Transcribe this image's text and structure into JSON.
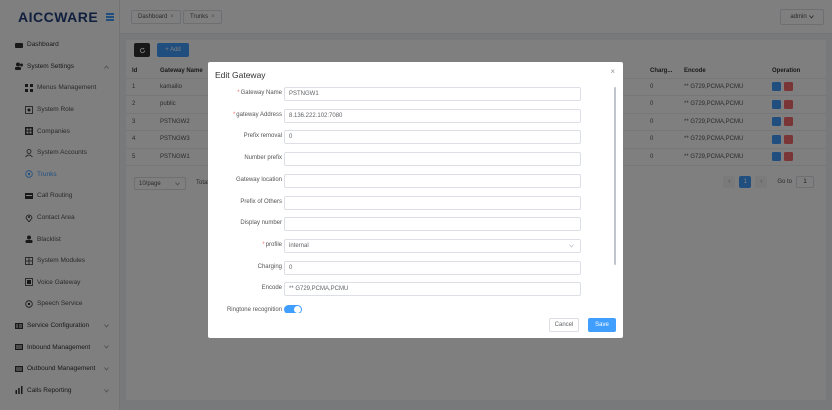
{
  "app": {
    "logo": "AICCWARE"
  },
  "sidebar": {
    "items": [
      {
        "label": "Dashboard",
        "icon": "dashboard-icon"
      },
      {
        "label": "System Settings",
        "icon": "users-icon"
      },
      {
        "label": "Menus Management",
        "icon": "grid-icon"
      },
      {
        "label": "System Role",
        "icon": "role-icon"
      },
      {
        "label": "Companies",
        "icon": "company-icon"
      },
      {
        "label": "System Accounts",
        "icon": "account-icon"
      },
      {
        "label": "Trunks",
        "icon": "trunk-icon"
      },
      {
        "label": "Call Routing",
        "icon": "routing-icon"
      },
      {
        "label": "Contact Area",
        "icon": "location-icon"
      },
      {
        "label": "Blacklist",
        "icon": "blacklist-icon"
      },
      {
        "label": "System Modules",
        "icon": "modules-icon"
      },
      {
        "label": "Voice Gateway",
        "icon": "gateway-icon"
      },
      {
        "label": "Speech Service",
        "icon": "speech-icon"
      },
      {
        "label": "Service Configuration",
        "icon": "config-icon"
      },
      {
        "label": "Inbound Management",
        "icon": "inbound-icon"
      },
      {
        "label": "Outbound Management",
        "icon": "outbound-icon"
      },
      {
        "label": "Calls Reporting",
        "icon": "report-icon"
      }
    ]
  },
  "header": {
    "tabs": [
      {
        "label": "Dashboard"
      },
      {
        "label": "Trunks"
      }
    ],
    "user": "admin"
  },
  "toolbar": {
    "add_label": "+ Add"
  },
  "table": {
    "headers": {
      "id": "Id",
      "name": "Gateway Name",
      "charge": "Charg...",
      "encode": "Encode",
      "operation": "Operation"
    },
    "rows": [
      {
        "id": "1",
        "name": "kamailio",
        "charge": "0",
        "encode": "** G729,PCMA,PCMU"
      },
      {
        "id": "2",
        "name": "public",
        "charge": "0",
        "encode": "** G729,PCMA,PCMU"
      },
      {
        "id": "3",
        "name": "PSTNGW2",
        "charge": "0",
        "encode": "** G729,PCMA,PCMU"
      },
      {
        "id": "4",
        "name": "PSTNGW3",
        "charge": "0",
        "encode": "** G729,PCMA,PCMU"
      },
      {
        "id": "5",
        "name": "PSTNGW1",
        "charge": "0",
        "encode": "** G729,PCMA,PCMU"
      }
    ]
  },
  "pager": {
    "page_size": "10/page",
    "total": "Total",
    "current": "1",
    "goto": "Go to",
    "goto_value": "1"
  },
  "dialog": {
    "title": "Edit Gateway",
    "fields": [
      {
        "label": "Gateway Name",
        "required": "*",
        "value": "PSTNGW1"
      },
      {
        "label": "gateway Address",
        "required": "*",
        "value": "8.136.222.102:7080"
      },
      {
        "label": "Prefix removal",
        "required": "",
        "value": "0"
      },
      {
        "label": "Number prefix",
        "required": "",
        "value": ""
      },
      {
        "label": "Gateway location",
        "required": "",
        "value": ""
      },
      {
        "label": "Prefix of Others",
        "required": "",
        "value": ""
      },
      {
        "label": "Display number",
        "required": "",
        "value": ""
      },
      {
        "label": "profile",
        "required": "*",
        "value": "internal"
      },
      {
        "label": "Charging",
        "required": "",
        "value": "0"
      },
      {
        "label": "Encode",
        "required": "",
        "value": "** G729,PCMA,PCMU"
      },
      {
        "label": "Ringtone recognition",
        "required": "",
        "value": ""
      }
    ],
    "cancel_label": "Cancel",
    "save_label": "Save"
  }
}
